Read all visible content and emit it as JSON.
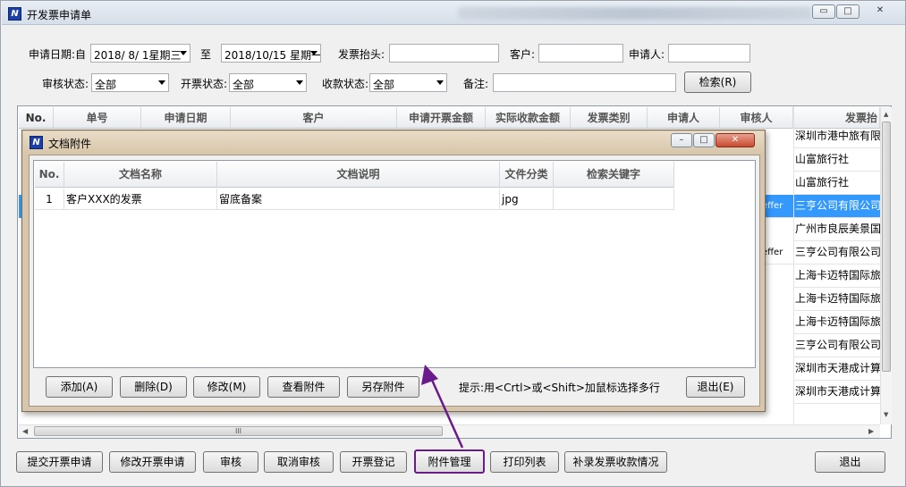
{
  "window": {
    "title": "开发票申请单",
    "controls": {
      "minimize": "▭",
      "maximize": "□",
      "close": "✕"
    }
  },
  "filters": {
    "date_label": "申请日期:自",
    "date_from": "2018/ 8/ 1星期三",
    "date_to_label": "至",
    "date_to": "2018/10/15 星期一",
    "invoice_title_label": "发票抬头:",
    "invoice_title_value": "",
    "customer_label": "客户:",
    "customer_value": "",
    "applicant_label": "申请人:",
    "applicant_value": "",
    "audit_status_label": "审核状态:",
    "audit_status_value": "全部",
    "invoice_status_label": "开票状态:",
    "invoice_status_value": "全部",
    "payment_status_label": "收款状态:",
    "payment_status_value": "全部",
    "remark_label": "备注:",
    "remark_value": "",
    "search_button": "检索(R)"
  },
  "grid": {
    "columns": [
      "No.",
      "单号",
      "申请日期",
      "客户",
      "申请开票金额",
      "实际收款金额",
      "发票类别",
      "申请人",
      "审核人",
      "发票抬"
    ],
    "applicant_fragments": [
      "effer",
      "effer"
    ],
    "title_column": [
      "深圳市港中旅有限",
      "山富旅行社",
      "山富旅行社",
      "三亨公司有限公司",
      "广州市良辰美景国",
      "三亨公司有限公司",
      "上海卡迈特国际旅",
      "上海卡迈特国际旅",
      "上海卡迈特国际旅",
      "三亨公司有限公司",
      "深圳市天港成计算",
      "深圳市天港成计算"
    ],
    "scroll_thumb": "III"
  },
  "dialog": {
    "title": "文档附件",
    "columns": [
      "No.",
      "文档名称",
      "文档说明",
      "文件分类",
      "检索关键字"
    ],
    "rows": [
      {
        "no": "1",
        "name": "客户XXX的发票",
        "description": "留底备案",
        "category": "jpg",
        "keyword": ""
      }
    ],
    "buttons": {
      "add": "添加(A)",
      "delete": "删除(D)",
      "edit": "修改(M)",
      "view": "查看附件",
      "save_as": "另存附件",
      "exit": "退出(E)"
    },
    "hint": "提示:用<Crtl>或<Shift>加鼠标选择多行"
  },
  "toolbar": {
    "submit": "提交开票申请",
    "modify": "修改开票申请",
    "audit": "审核",
    "cancel_audit": "取消审核",
    "register": "开票登记",
    "attachments": "附件管理",
    "print_list": "打印列表",
    "supplement": "补录发票收款情况",
    "exit": "退出"
  },
  "annotation": {
    "highlight_color": "#6b1a8c"
  }
}
